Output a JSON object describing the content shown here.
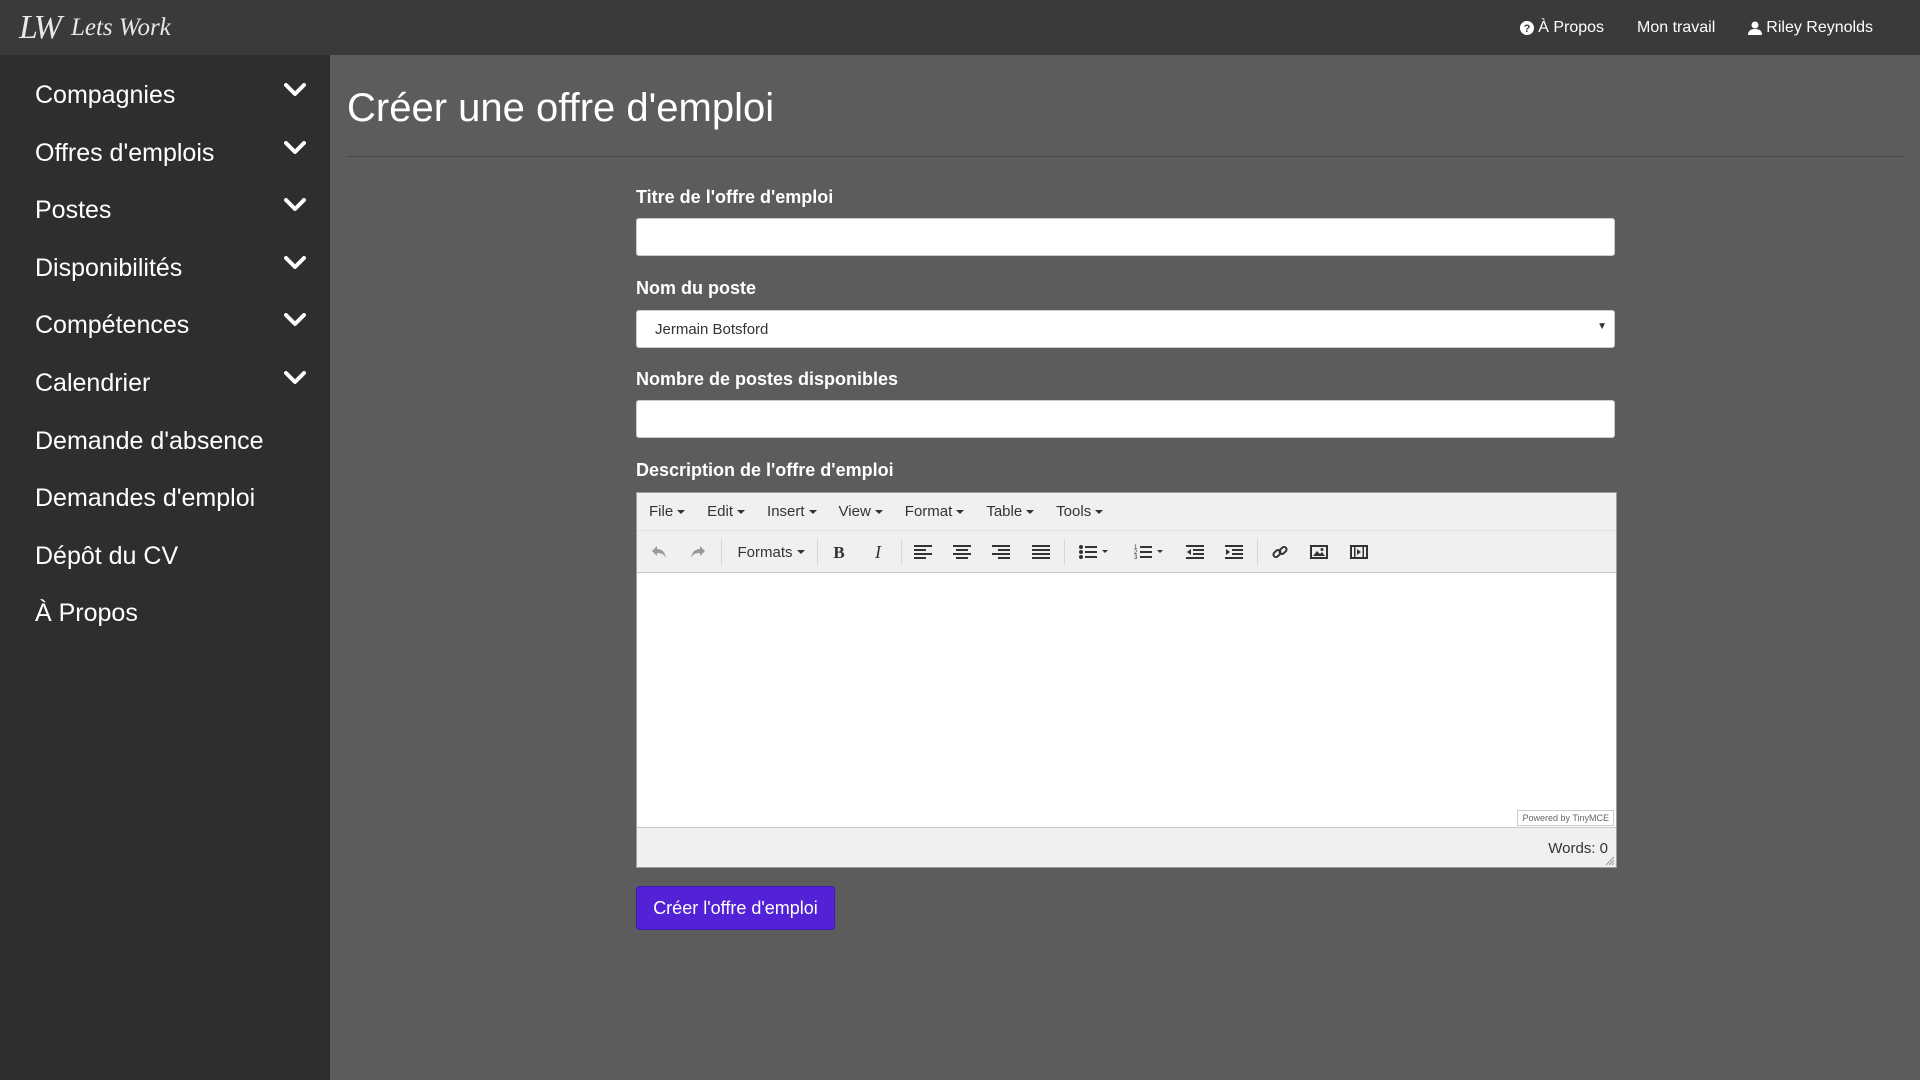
{
  "navbar": {
    "logo_text": "LW",
    "brand_name": "Lets Work",
    "links": [
      {
        "label": "À Propos",
        "icon": "question-circle-icon"
      },
      {
        "label": "Mon travail",
        "icon": ""
      },
      {
        "label": "Riley Reynolds",
        "icon": "user-icon"
      }
    ]
  },
  "sidebar": {
    "items": [
      {
        "label": "Compagnies",
        "expandable": true
      },
      {
        "label": "Offres d'emplois",
        "expandable": true
      },
      {
        "label": "Postes",
        "expandable": true
      },
      {
        "label": "Disponibilités",
        "expandable": true
      },
      {
        "label": "Compétences",
        "expandable": true
      },
      {
        "label": "Calendrier",
        "expandable": true
      },
      {
        "label": "Demande d'absence",
        "expandable": false
      },
      {
        "label": "Demandes d'emploi",
        "expandable": false
      },
      {
        "label": "Dépôt du CV",
        "expandable": false
      },
      {
        "label": "À Propos",
        "expandable": false
      }
    ]
  },
  "main": {
    "title": "Créer une offre d'emploi",
    "form": {
      "title_label": "Titre de l'offre d'emploi",
      "title_value": "",
      "position_label": "Nom du poste",
      "position_selected": "Jermain Botsford",
      "count_label": "Nombre de postes disponibles",
      "count_value": "",
      "description_label": "Description de l'offre d'emploi",
      "submit_label": "Créer l'offre d'emploi"
    },
    "editor": {
      "menus": [
        "File",
        "Edit",
        "Insert",
        "View",
        "Format",
        "Table",
        "Tools"
      ],
      "formats_label": "Formats",
      "powered_by": "Powered by TinyMCE",
      "word_count": "Words: 0"
    }
  },
  "colors": {
    "navbar_bg": "#3a3a3a",
    "sidebar_bg": "#2e2e2e",
    "main_bg": "#5c5c5c",
    "accent": "#5321d6"
  }
}
